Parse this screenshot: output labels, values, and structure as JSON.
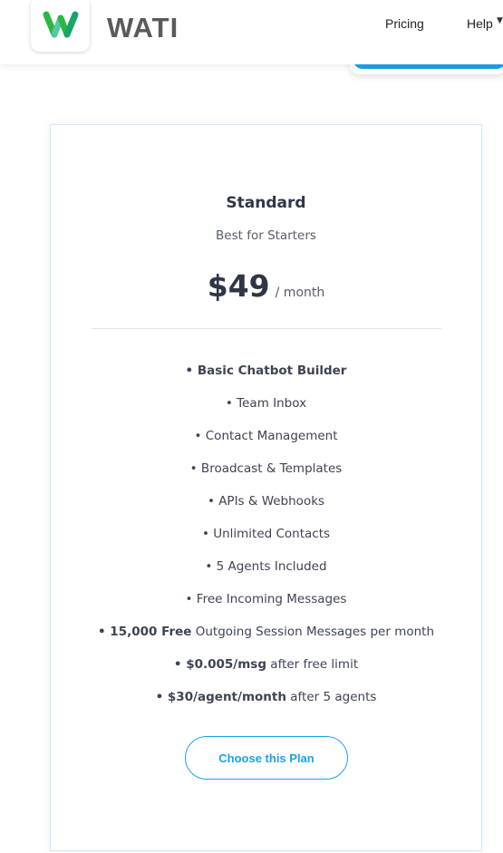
{
  "header": {
    "logo_text": "WATI",
    "nav": {
      "pricing": "Pricing",
      "help": "Help"
    }
  },
  "plan": {
    "name": "Standard",
    "subtitle": "Best for Starters",
    "price": "$49",
    "period": "/ month",
    "features": [
      {
        "bold": "• Basic Chatbot Builder",
        "rest": ""
      },
      {
        "bold": "",
        "rest": "• Team Inbox"
      },
      {
        "bold": "",
        "rest": "• Contact Management"
      },
      {
        "bold": "",
        "rest": "• Broadcast & Templates"
      },
      {
        "bold": "",
        "rest": "• APIs & Webhooks"
      },
      {
        "bold": "",
        "rest": "• Unlimited Contacts"
      },
      {
        "bold": "",
        "rest": "• 5 Agents Included"
      },
      {
        "bold": "",
        "rest": "• Free Incoming Messages"
      },
      {
        "bold": "• 15,000 Free",
        "rest": " Outgoing Session Messages per month"
      },
      {
        "bold": "• $0.005/msg",
        "rest": " after free limit"
      },
      {
        "bold": "• $30/agent/month",
        "rest": " after 5 agents"
      }
    ],
    "cta": "Choose this Plan"
  },
  "colors": {
    "accent": "#1aa3e8",
    "logo_green": "#2bb741",
    "text_dark": "#2f3645"
  },
  "icons": {
    "logo": "wati-w-logo-icon",
    "help_dropdown": "chevron-down-icon"
  }
}
